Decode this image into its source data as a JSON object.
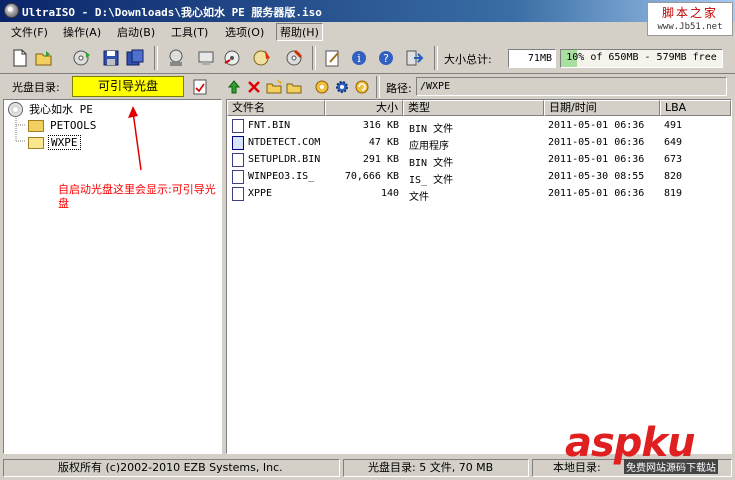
{
  "window": {
    "title": "UltraISO - D:\\Downloads\\我心如水 PE 服务器版.iso"
  },
  "watermark": {
    "title": "脚本之家",
    "url": "www.Jb51.net"
  },
  "menu": {
    "items": [
      {
        "label": "文件(F)"
      },
      {
        "label": "操作(A)"
      },
      {
        "label": "启动(B)"
      },
      {
        "label": "工具(T)"
      },
      {
        "label": "选项(O)"
      },
      {
        "label": "帮助(H)"
      }
    ],
    "active_index": 5
  },
  "toolbar": {
    "size_label": "大小总计:",
    "size_value": "71MB",
    "capacity_text": "10% of 650MB - 579MB free",
    "capacity_fraction": 0.1
  },
  "cd_row": {
    "label": "光盘目录:",
    "value": "可引导光盘",
    "path_label": "路径:",
    "path_value": "/WXPE"
  },
  "tree": {
    "root": "我心如水 PE",
    "children": [
      "PETOOLS",
      "WXPE"
    ],
    "selected": "WXPE"
  },
  "annotation": {
    "text": "自启动光盘这里会显示:可引导光盘"
  },
  "file_list": {
    "columns": [
      "文件名",
      "大小",
      "类型",
      "日期/时间",
      "LBA"
    ],
    "rows": [
      {
        "name": "FNT.BIN",
        "size": "316 KB",
        "type": "BIN 文件",
        "date": "2011-05-01 06:36",
        "lba": "491"
      },
      {
        "name": "NTDETECT.COM",
        "size": "47 KB",
        "type": "应用程序",
        "date": "2011-05-01 06:36",
        "lba": "649"
      },
      {
        "name": "SETUPLDR.BIN",
        "size": "291 KB",
        "type": "BIN 文件",
        "date": "2011-05-01 06:36",
        "lba": "673"
      },
      {
        "name": "WINPEO3.IS_",
        "size": "70,666 KB",
        "type": "IS_ 文件",
        "date": "2011-05-30 08:55",
        "lba": "820"
      },
      {
        "name": "XPPE",
        "size": "140",
        "type": "文件",
        "date": "2011-05-01 06:36",
        "lba": "819"
      }
    ]
  },
  "statusbar": {
    "copyright": "版权所有 (c)2002-2010 EZB Systems, Inc.",
    "cd_info": "光盘目录: 5 文件, 70 MB",
    "local_info": "本地目录:"
  },
  "logo": {
    "main": "aspku",
    "sub": "免费网站源码下载站"
  }
}
